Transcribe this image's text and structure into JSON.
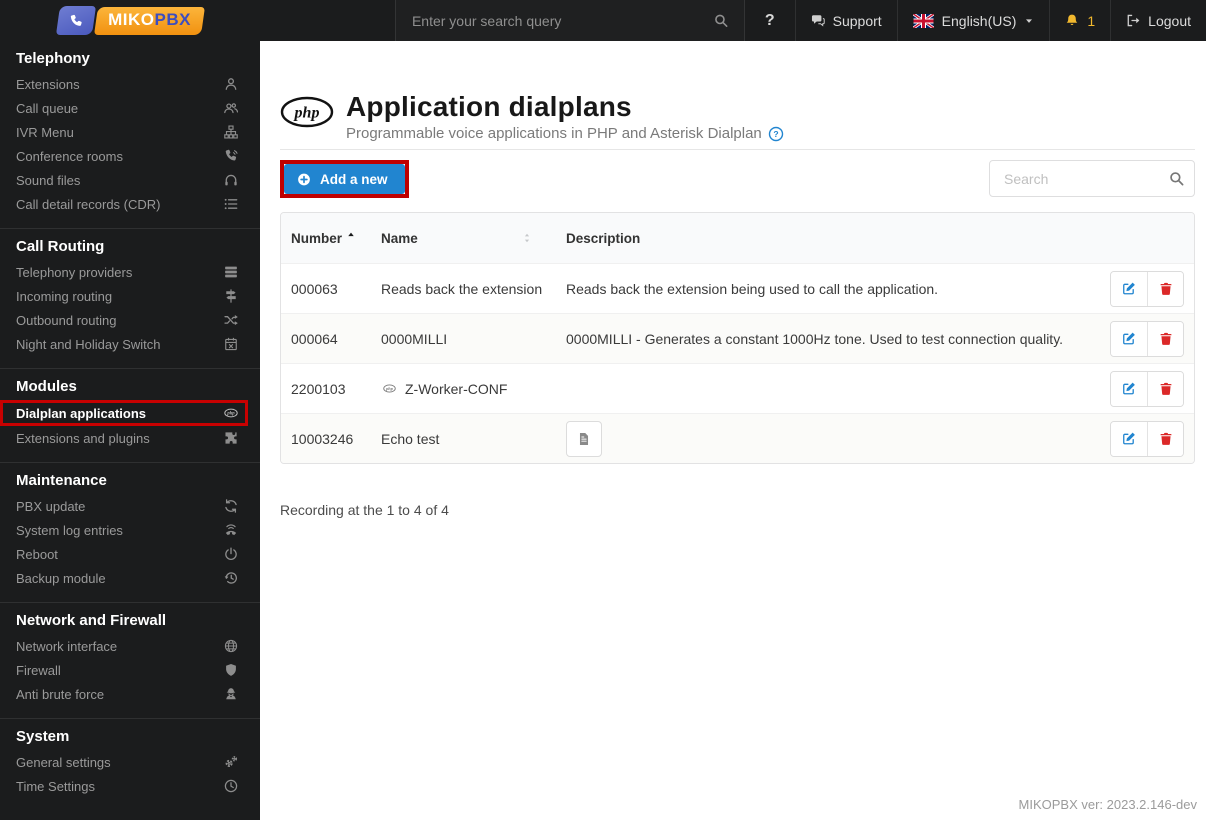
{
  "topbar": {
    "search_placeholder": "Enter your search query",
    "help_label": "?",
    "support_label": "Support",
    "language_label": "English(US)",
    "notifications_count": "1",
    "logout_label": "Logout"
  },
  "sidebar": {
    "logo": {
      "brand_left": "MIKO",
      "brand_right": "PBX"
    },
    "sections": [
      {
        "title": "Telephony",
        "items": [
          {
            "label": "Extensions",
            "icon": "user-icon"
          },
          {
            "label": "Call queue",
            "icon": "users-icon"
          },
          {
            "label": "IVR Menu",
            "icon": "sitemap-icon"
          },
          {
            "label": "Conference rooms",
            "icon": "phone-volume-icon"
          },
          {
            "label": "Sound files",
            "icon": "headphones-icon"
          },
          {
            "label": "Call detail records (CDR)",
            "icon": "list-icon"
          }
        ]
      },
      {
        "title": "Call Routing",
        "items": [
          {
            "label": "Telephony providers",
            "icon": "server-icon"
          },
          {
            "label": "Incoming routing",
            "icon": "route-signs-icon"
          },
          {
            "label": "Outbound routing",
            "icon": "shuffle-icon"
          },
          {
            "label": "Night and Holiday Switch",
            "icon": "calendar-times-icon"
          }
        ]
      },
      {
        "title": "Modules",
        "items": [
          {
            "label": "Dialplan applications",
            "icon": "php-icon",
            "active": true
          },
          {
            "label": "Extensions and plugins",
            "icon": "puzzle-icon"
          }
        ]
      },
      {
        "title": "Maintenance",
        "items": [
          {
            "label": "PBX update",
            "icon": "sync-icon"
          },
          {
            "label": "System log entries",
            "icon": "phone-log-icon"
          },
          {
            "label": "Reboot",
            "icon": "power-icon"
          },
          {
            "label": "Backup module",
            "icon": "history-icon"
          }
        ]
      },
      {
        "title": "Network and Firewall",
        "items": [
          {
            "label": "Network interface",
            "icon": "globe-icon"
          },
          {
            "label": "Firewall",
            "icon": "shield-icon"
          },
          {
            "label": "Anti brute force",
            "icon": "user-secret-icon"
          }
        ]
      },
      {
        "title": "System",
        "items": [
          {
            "label": "General settings",
            "icon": "cogs-icon"
          },
          {
            "label": "Time Settings",
            "icon": "clock-icon"
          }
        ]
      }
    ]
  },
  "page": {
    "title": "Application dialplans",
    "subtitle": "Programmable voice applications in PHP and Asterisk Dialplan",
    "add_button_label": "Add a new",
    "search_placeholder": "Search",
    "footer_summary": "Recording at the 1 to 4 of 4",
    "version": "MIKOPBX ver: 2023.2.146-dev"
  },
  "table": {
    "columns": [
      {
        "label": "Number",
        "sort": "asc"
      },
      {
        "label": "Name",
        "sort": "none"
      },
      {
        "label": "Description",
        "sort": null
      }
    ],
    "rows": [
      {
        "number": "000063",
        "name": "Reads back the extension",
        "name_has_php_icon": false,
        "description": "Reads back the extension being used to call the application.",
        "has_file_button": false
      },
      {
        "number": "000064",
        "name": "0000MILLI",
        "name_has_php_icon": false,
        "description": "0000MILLI - Generates a constant 1000Hz tone. Used to test connection quality.",
        "has_file_button": false
      },
      {
        "number": "2200103",
        "name": "Z-Worker-CONF",
        "name_has_php_icon": true,
        "description": "",
        "has_file_button": false
      },
      {
        "number": "10003246",
        "name": "Echo test",
        "name_has_php_icon": false,
        "description": "",
        "has_file_button": true
      }
    ]
  },
  "colors": {
    "accent_blue": "#2185d0",
    "annotation_red": "#c80101",
    "delete_red": "#db2828",
    "bell_yellow": "#f1b82e",
    "sidebar_bg": "#1b1c1d"
  }
}
